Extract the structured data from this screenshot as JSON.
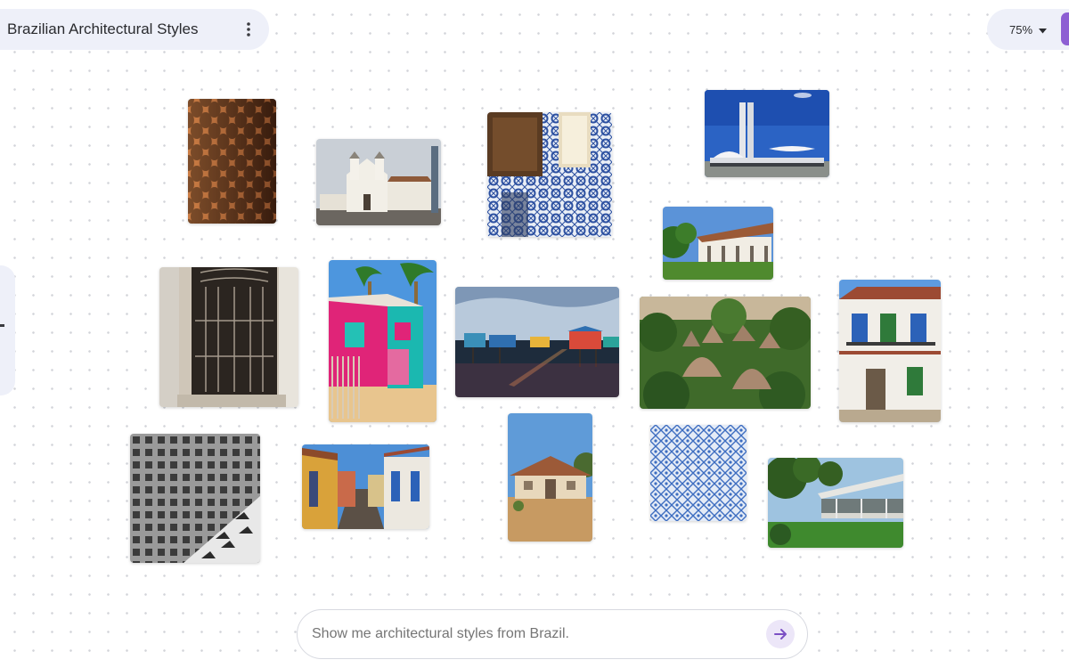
{
  "header": {
    "title": "Brazilian Architectural Styles",
    "menu_icon": "more-vertical-icon"
  },
  "zoom": {
    "label": "75%",
    "caret_icon": "caret-down-icon"
  },
  "prompt": {
    "placeholder": "Show me architectural styles from Brazil.",
    "send_icon": "arrow-right-icon"
  },
  "colors": {
    "accent": "#8d5fd3",
    "pill_background": "#eef0f9",
    "send_button_background": "#ece6f8",
    "send_arrow": "#7b4fc4"
  },
  "images": [
    {
      "id": "cobogo-brick-pattern"
    },
    {
      "id": "colonial-white-church"
    },
    {
      "id": "azulejo-tiled-interior"
    },
    {
      "id": "brasilia-national-congress"
    },
    {
      "id": "colonial-veranda-house"
    },
    {
      "id": "wrought-iron-window"
    },
    {
      "id": "colorful-beach-house"
    },
    {
      "id": "stilt-houses-on-water"
    },
    {
      "id": "indigenous-thatched-huts"
    },
    {
      "id": "colonial-townhouse-blue-shutters"
    },
    {
      "id": "concrete-cobogo-wall"
    },
    {
      "id": "colonial-street-houses"
    },
    {
      "id": "rural-adobe-house"
    },
    {
      "id": "blue-azulejo-tile-pattern"
    },
    {
      "id": "modernist-house-garden"
    }
  ]
}
